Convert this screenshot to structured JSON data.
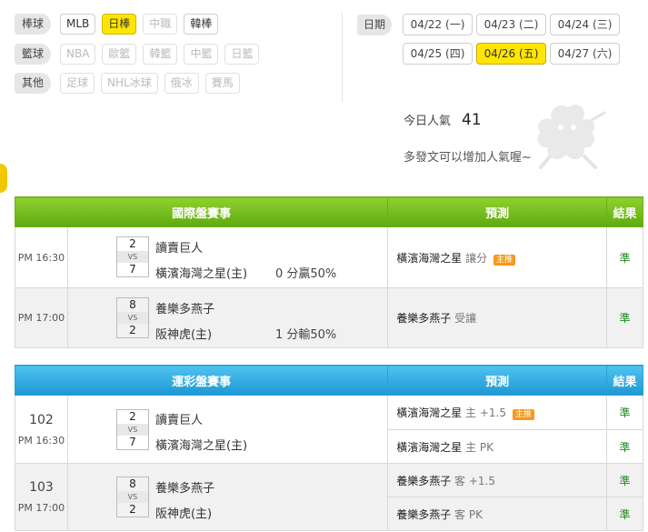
{
  "filters": {
    "baseball": {
      "label": "棒球",
      "options": [
        "MLB",
        "日棒",
        "中職",
        "韓棒"
      ],
      "active_index": 1,
      "disabled": [
        2
      ]
    },
    "basketball": {
      "label": "籃球",
      "options": [
        "NBA",
        "歐籃",
        "韓籃",
        "中籃",
        "日籃"
      ],
      "disabled": [
        0,
        1,
        2,
        3,
        4
      ]
    },
    "other": {
      "label": "其他",
      "options": [
        "足球",
        "NHL冰球",
        "俄冰",
        "賽馬"
      ],
      "disabled": [
        0,
        1,
        2,
        3
      ]
    }
  },
  "dates": {
    "label": "日期",
    "items": [
      "04/22 (一)",
      "04/23 (二)",
      "04/24 (三)",
      "04/25 (四)",
      "04/26 (五)",
      "04/27 (六)"
    ],
    "active_index": 4
  },
  "popularity": {
    "label": "今日人氣",
    "value": "41",
    "hint": "多發文可以增加人氣喔~"
  },
  "intl": {
    "title": "國際盤賽事",
    "pred_header": "預測",
    "result_header": "結果",
    "games": [
      {
        "time": "PM 16:30",
        "score1": "2",
        "vs": "VS",
        "score2": "7",
        "team1": "讀賣巨人",
        "team2": "橫濱海灣之星(主)",
        "line": "0 分贏50%",
        "pred_team": "橫濱海灣之星",
        "pred_sub": "讓分",
        "badge": "主推",
        "result": "準"
      },
      {
        "time": "PM 17:00",
        "score1": "8",
        "vs": "VS",
        "score2": "2",
        "team1": "養樂多燕子",
        "team2": "阪神虎(主)",
        "line": "1 分輸50%",
        "pred_team": "養樂多燕子",
        "pred_sub": "受讓",
        "badge": "",
        "result": "準"
      }
    ]
  },
  "lottery": {
    "title": "運彩盤賽事",
    "pred_header": "預測",
    "result_header": "結果",
    "games": [
      {
        "id": "102",
        "time": "PM 16:30",
        "score1": "2",
        "vs": "VS",
        "score2": "7",
        "team1": "讀賣巨人",
        "team2": "橫濱海灣之星(主)",
        "preds": [
          {
            "team": "橫濱海灣之星",
            "sub": "主 +1.5",
            "badge": "主推",
            "result": "準"
          },
          {
            "team": "橫濱海灣之星",
            "sub": "主 PK",
            "badge": "",
            "result": "準"
          }
        ]
      },
      {
        "id": "103",
        "time": "PM 17:00",
        "score1": "8",
        "vs": "VS",
        "score2": "2",
        "team1": "養樂多燕子",
        "team2": "阪神虎(主)",
        "preds": [
          {
            "team": "養樂多燕子",
            "sub": "客 +1.5",
            "badge": "",
            "result": "準"
          },
          {
            "team": "養樂多燕子",
            "sub": "客 PK",
            "badge": "",
            "result": "準"
          }
        ]
      }
    ]
  }
}
